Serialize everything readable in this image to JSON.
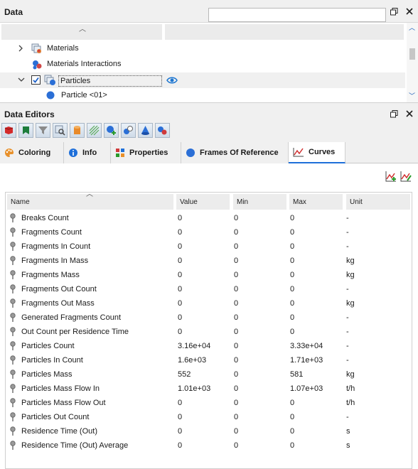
{
  "data_panel": {
    "title": "Data",
    "search_placeholder": "",
    "tree": [
      {
        "label": "Materials",
        "indent": 1,
        "expander": ">",
        "icon": "materials-icon"
      },
      {
        "label": "Materials Interactions",
        "indent": 1,
        "expander": "",
        "icon": "materials-interactions-icon"
      },
      {
        "label": "Particles",
        "indent": 1,
        "expander": "v",
        "icon": "particles-icon",
        "checked": true,
        "selected": true
      },
      {
        "label": "Particle <01>",
        "indent": 2,
        "expander": "",
        "icon": "particle-sphere-icon"
      }
    ]
  },
  "editors_panel": {
    "title": "Data Editors",
    "toolbar_icons": [
      "red-cube-icon",
      "green-shape-icon",
      "funnel-icon",
      "search-grid-icon",
      "cylinder-icon",
      "mesh-icon",
      "add-sphere-icon",
      "spheres-icon",
      "cone-icon",
      "particle-pair-icon"
    ],
    "tabs": [
      {
        "label": "Coloring",
        "icon": "palette-icon"
      },
      {
        "label": "Info",
        "icon": "info-icon"
      },
      {
        "label": "Properties",
        "icon": "properties-icon"
      },
      {
        "label": "Frames Of Reference",
        "icon": "sphere-icon"
      },
      {
        "label": "Curves",
        "icon": "curves-icon",
        "active": true
      }
    ],
    "grid": {
      "columns": [
        "Name",
        "Value",
        "Min",
        "Max",
        "Unit"
      ],
      "rows": [
        [
          "Breaks Count",
          "0",
          "0",
          "0",
          "-"
        ],
        [
          "Fragments Count",
          "0",
          "0",
          "0",
          "-"
        ],
        [
          "Fragments In Count",
          "0",
          "0",
          "0",
          "-"
        ],
        [
          "Fragments In Mass",
          "0",
          "0",
          "0",
          "kg"
        ],
        [
          "Fragments Mass",
          "0",
          "0",
          "0",
          "kg"
        ],
        [
          "Fragments Out Count",
          "0",
          "0",
          "0",
          "-"
        ],
        [
          "Fragments Out Mass",
          "0",
          "0",
          "0",
          "kg"
        ],
        [
          "Generated Fragments Count",
          "0",
          "0",
          "0",
          "-"
        ],
        [
          "Out Count per Residence Time",
          "0",
          "0",
          "0",
          "-"
        ],
        [
          "Particles Count",
          "3.16e+04",
          "0",
          "3.33e+04",
          "-"
        ],
        [
          "Particles In Count",
          "1.6e+03",
          "0",
          "1.71e+03",
          "-"
        ],
        [
          "Particles Mass",
          "552",
          "0",
          "581",
          "kg"
        ],
        [
          "Particles Mass Flow In",
          "1.01e+03",
          "0",
          "1.07e+03",
          "t/h"
        ],
        [
          "Particles Mass Flow Out",
          "0",
          "0",
          "0",
          "t/h"
        ],
        [
          "Particles Out Count",
          "0",
          "0",
          "0",
          "-"
        ],
        [
          "Residence Time (Out)",
          "0",
          "0",
          "0",
          "s"
        ],
        [
          "Residence Time (Out) Average",
          "0",
          "0",
          "0",
          "s"
        ]
      ]
    }
  },
  "colors": {
    "accent": "#1e6fd9",
    "eye": "#1b75d0"
  }
}
